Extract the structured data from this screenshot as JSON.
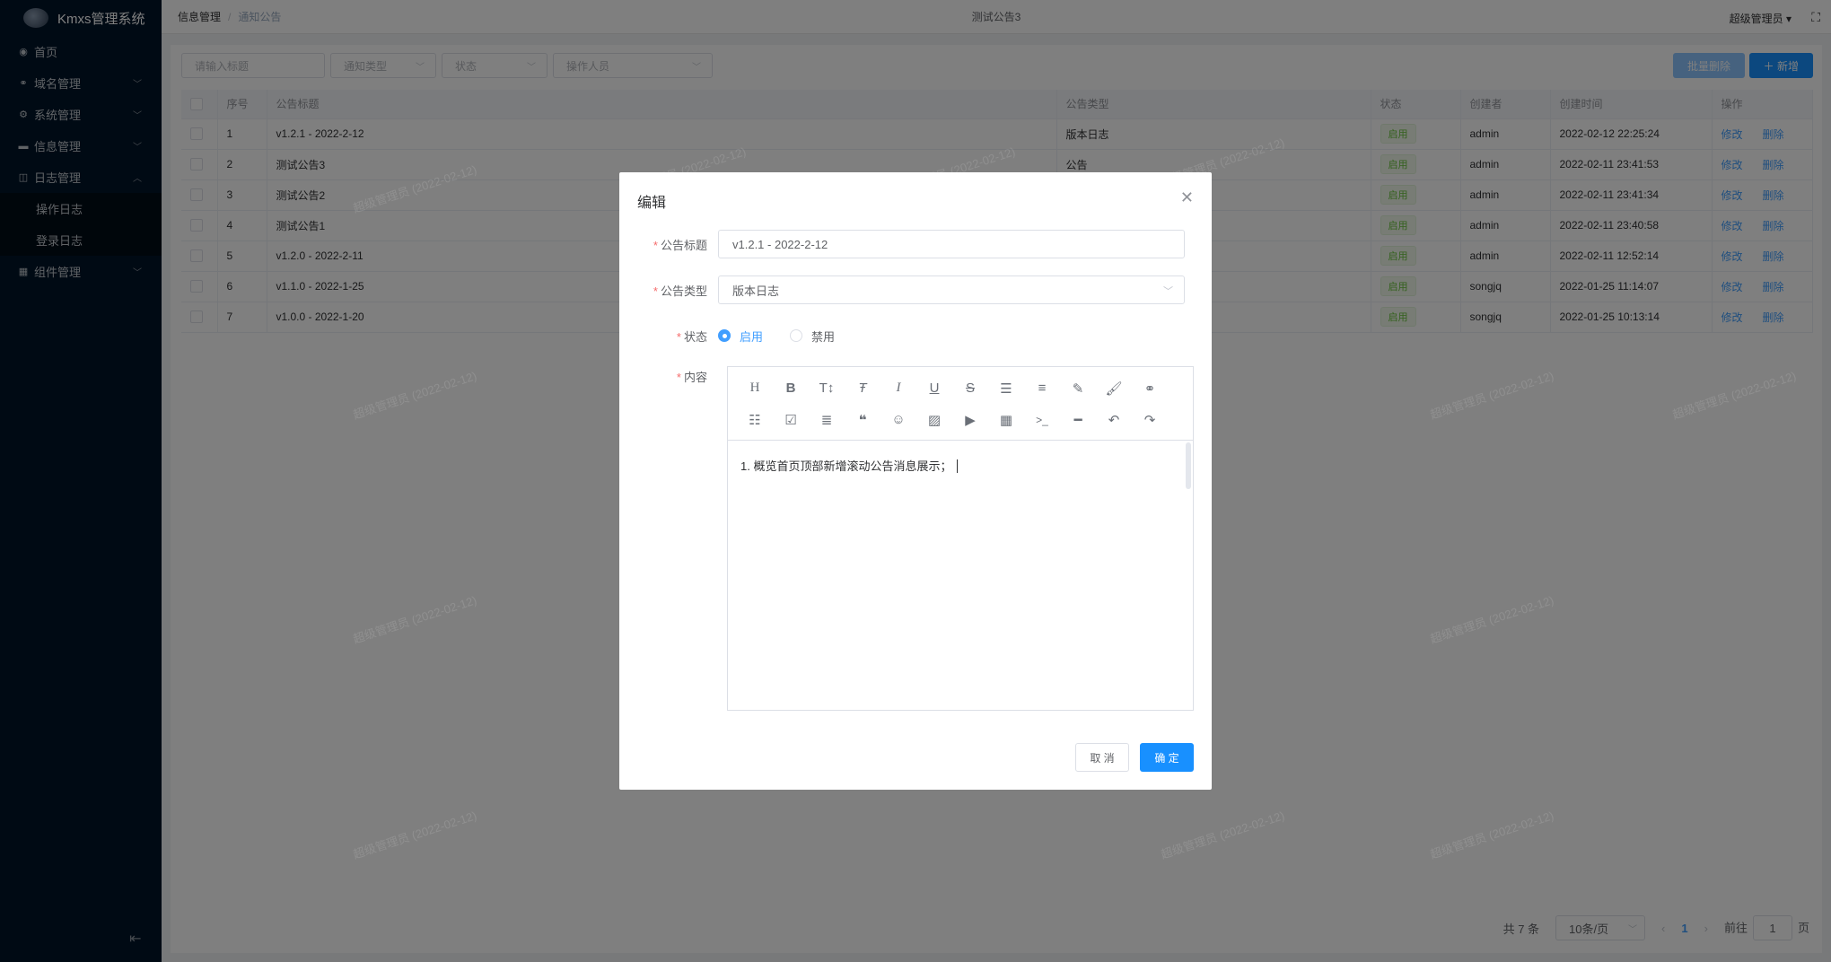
{
  "app": {
    "title": "Kmxs管理系统"
  },
  "sidebar": {
    "items": [
      {
        "label": "首页"
      },
      {
        "label": "域名管理"
      },
      {
        "label": "系统管理"
      },
      {
        "label": "信息管理"
      },
      {
        "label": "日志管理"
      },
      {
        "label": "操作日志"
      },
      {
        "label": "登录日志"
      },
      {
        "label": "组件管理"
      }
    ]
  },
  "header": {
    "breadcrumb": [
      "信息管理",
      "通知公告"
    ],
    "center_tab": "测试公告3",
    "user": "超级管理员"
  },
  "filters": {
    "title_placeholder": "请输入标题",
    "type_placeholder": "通知类型",
    "status_placeholder": "状态",
    "operator_placeholder": "操作人员"
  },
  "actions": {
    "batch_delete": "批量删除",
    "add": "新增"
  },
  "table": {
    "columns": [
      "序号",
      "公告标题",
      "公告类型",
      "状态",
      "创建者",
      "创建时间",
      "操作"
    ],
    "rows": [
      {
        "no": "1",
        "title": "v1.2.1 - 2022-2-12",
        "type": "版本日志",
        "status": "启用",
        "creator": "admin",
        "time": "2022-02-12 22:25:24"
      },
      {
        "no": "2",
        "title": "测试公告3",
        "type": "公告",
        "status": "启用",
        "creator": "admin",
        "time": "2022-02-11 23:41:53"
      },
      {
        "no": "3",
        "title": "测试公告2",
        "type": "",
        "status": "启用",
        "creator": "admin",
        "time": "2022-02-11 23:41:34"
      },
      {
        "no": "4",
        "title": "测试公告1",
        "type": "",
        "status": "启用",
        "creator": "admin",
        "time": "2022-02-11 23:40:58"
      },
      {
        "no": "5",
        "title": "v1.2.0 - 2022-2-11",
        "type": "",
        "status": "启用",
        "creator": "admin",
        "time": "2022-02-11 12:52:14"
      },
      {
        "no": "6",
        "title": "v1.1.0 - 2022-1-25",
        "type": "",
        "status": "启用",
        "creator": "songjq",
        "time": "2022-01-25 11:14:07"
      },
      {
        "no": "7",
        "title": "v1.0.0 - 2022-1-20",
        "type": "",
        "status": "启用",
        "creator": "songjq",
        "time": "2022-01-25 10:13:14"
      }
    ],
    "edit_label": "修改",
    "delete_label": "删除"
  },
  "pagination": {
    "total": "共 7 条",
    "page_size": "10条/页",
    "current": "1",
    "goto_label": "前往",
    "goto_value": "1",
    "page_suffix": "页"
  },
  "dialog": {
    "title": "编辑",
    "title_label": "公告标题",
    "title_value": "v1.2.1 - 2022-2-12",
    "type_label": "公告类型",
    "type_value": "版本日志",
    "status_label": "状态",
    "status_options": [
      "启用",
      "禁用"
    ],
    "status_selected": "启用",
    "content_label": "内容",
    "content_text": "1. 概览首页顶部新增滚动公告消息展示；",
    "cancel": "取 消",
    "confirm": "确 定"
  },
  "watermark": "超级管理员 (2022-02-12)",
  "colors": {
    "primary": "#1890ff",
    "sidebar": "#001529",
    "success": "#67c23a",
    "danger": "#f56c6c"
  }
}
